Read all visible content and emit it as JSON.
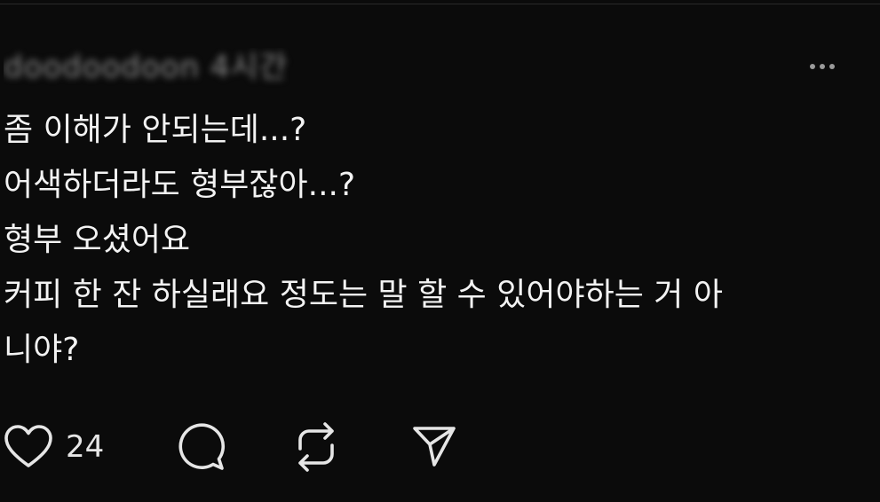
{
  "post": {
    "author_blurred": "doodoodoon 4시간",
    "lines": [
      "좀 이해가 안되는데...?",
      "어색하더라도 형부잖아...?",
      "형부 오셨어요",
      "커피 한 잔 하실래요 정도는 말 할 수 있어야하는 거 아",
      "니야?"
    ]
  },
  "actions": {
    "like_count": "24",
    "icons": [
      "heart-icon",
      "comment-icon",
      "repost-icon",
      "share-icon"
    ]
  },
  "colors": {
    "background": "#0b0b0b",
    "text": "#f3f3f3",
    "icon": "#e6e6e6",
    "muted": "#9a9a9a"
  }
}
